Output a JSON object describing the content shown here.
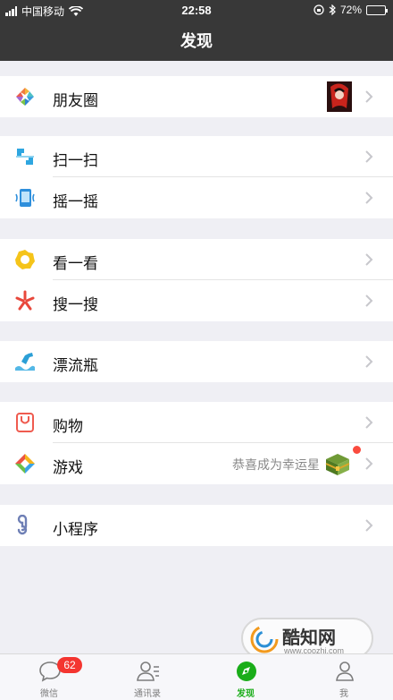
{
  "status_bar": {
    "carrier": "中国移动",
    "time": "22:58",
    "battery": "72%",
    "battery_level": 0.72
  },
  "header": {
    "title": "发现"
  },
  "menu": {
    "moments": {
      "label": "朋友圈",
      "icon": "moments-aperture-icon"
    },
    "scan": {
      "label": "扫一扫",
      "icon": "scan-icon"
    },
    "shake": {
      "label": "摇一摇",
      "icon": "shake-icon"
    },
    "top_stories": {
      "label": "看一看",
      "icon": "top-stories-icon"
    },
    "search": {
      "label": "搜一搜",
      "icon": "search-star-icon"
    },
    "drift_bottle": {
      "label": "漂流瓶",
      "icon": "drift-bottle-icon"
    },
    "shopping": {
      "label": "购物",
      "icon": "shopping-bag-icon"
    },
    "games": {
      "label": "游戏",
      "icon": "games-icon",
      "note": "恭喜成为幸运星"
    },
    "mini_programs": {
      "label": "小程序",
      "icon": "mini-program-icon"
    }
  },
  "tabbar": {
    "chats": {
      "label": "微信",
      "badge": "62"
    },
    "contacts": {
      "label": "通讯录"
    },
    "discover": {
      "label": "发现"
    },
    "me": {
      "label": "我"
    }
  },
  "watermark": {
    "title": "酷知网",
    "url": "www.coozhi.com"
  },
  "colors": {
    "accent": "#1aad19",
    "navbar": "#383838",
    "badge": "#f43530",
    "background": "#efeff4"
  }
}
